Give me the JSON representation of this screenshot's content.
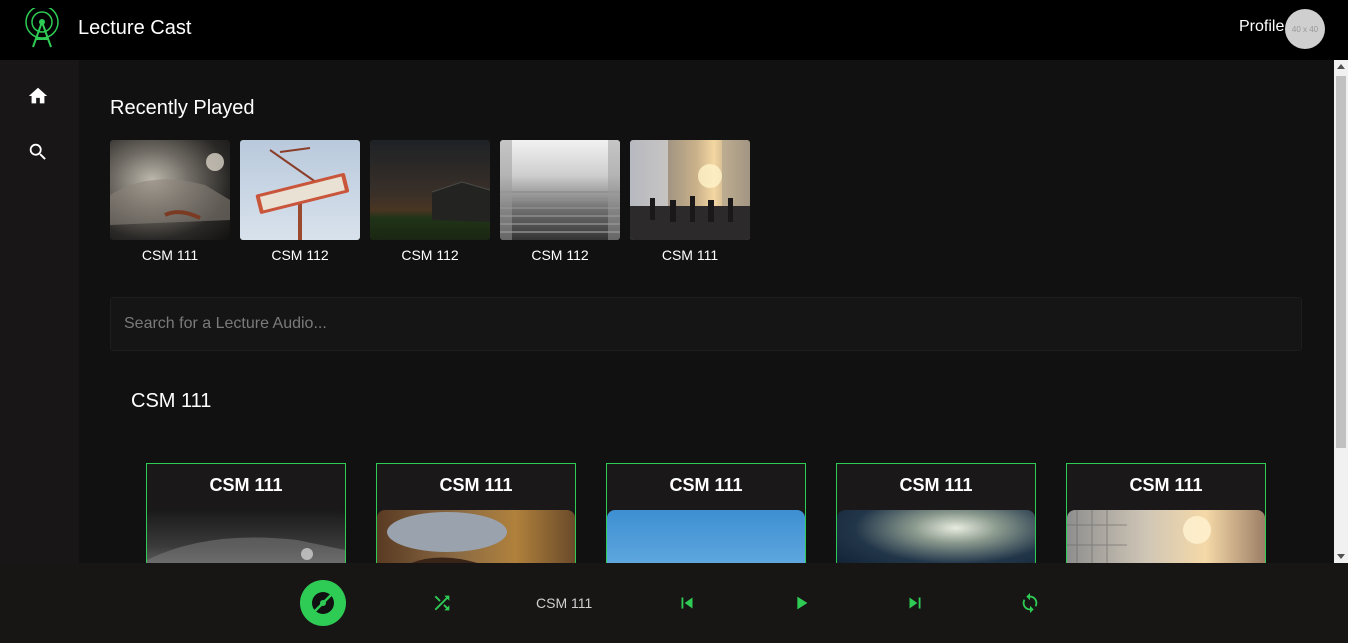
{
  "app": {
    "title": "Lecture Cast",
    "accent": "#2ecc55"
  },
  "header": {
    "profile_label": "Profile",
    "avatar_placeholder": "40 x 40"
  },
  "sidebar": {
    "items": [
      {
        "icon": "home-icon"
      },
      {
        "icon": "search-icon"
      }
    ]
  },
  "recent": {
    "title": "Recently Played",
    "items": [
      {
        "label": "CSM 111",
        "image": "vintage-car-photo"
      },
      {
        "label": "CSM 112",
        "image": "motel-sign-photo"
      },
      {
        "label": "CSM 112",
        "image": "barn-at-night-photo"
      },
      {
        "label": "CSM 112",
        "image": "foggy-stairs-photo"
      },
      {
        "label": "CSM 111",
        "image": "city-street-crowd-photo"
      }
    ]
  },
  "search": {
    "placeholder": "Search for a Lecture Audio..."
  },
  "course": {
    "heading": "CSM 111",
    "cards": [
      {
        "title": "CSM 111",
        "image": "car-bw-photo"
      },
      {
        "title": "CSM 111",
        "image": "person-in-hat-photo"
      },
      {
        "title": "CSM 111",
        "image": "blue-sky-photo"
      },
      {
        "title": "CSM 111",
        "image": "blurry-dark-photo"
      },
      {
        "title": "CSM 111",
        "image": "city-buildings-photo"
      }
    ]
  },
  "player": {
    "now_playing": "CSM 111"
  }
}
